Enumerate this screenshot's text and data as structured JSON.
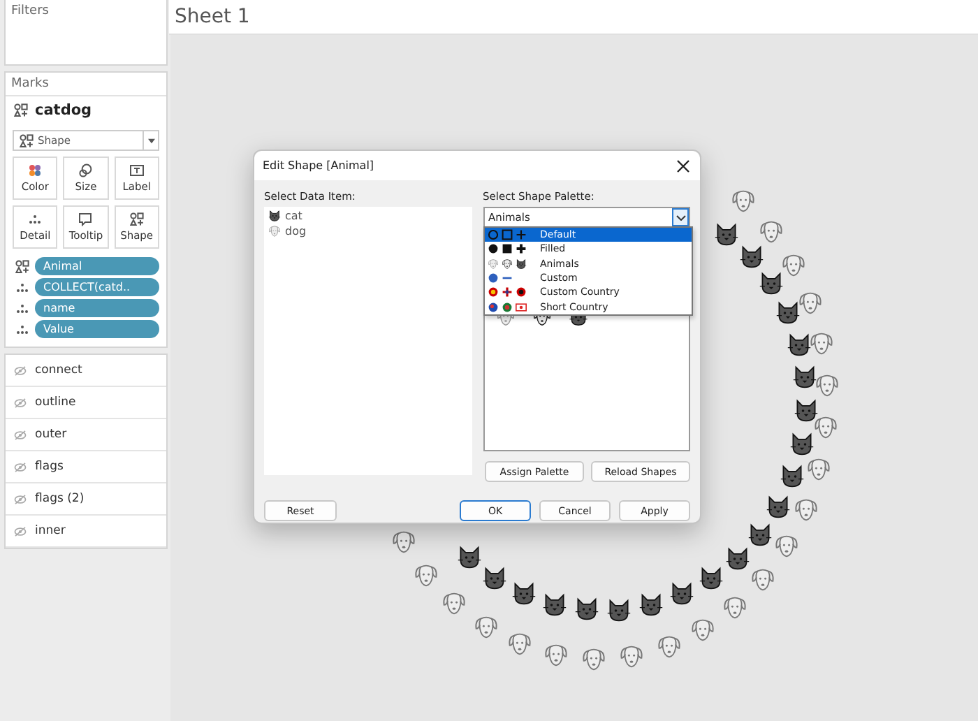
{
  "sidebar": {
    "filters_title": "Filters",
    "marks_title": "Marks",
    "layer_name": "catdog",
    "mark_type": "Shape",
    "mark_buttons": [
      {
        "label": "Color",
        "kind": "color"
      },
      {
        "label": "Size",
        "kind": "size"
      },
      {
        "label": "Label",
        "kind": "label"
      },
      {
        "label": "Detail",
        "kind": "detail"
      },
      {
        "label": "Tooltip",
        "kind": "tooltip"
      },
      {
        "label": "Shape",
        "kind": "shape"
      }
    ],
    "fields": [
      {
        "label": "Animal",
        "kind": "shape"
      },
      {
        "label": "COLLECT(catd..",
        "kind": "detail"
      },
      {
        "label": "name",
        "kind": "detail"
      },
      {
        "label": "Value",
        "kind": "detail"
      }
    ],
    "layers": [
      "connect",
      "outline",
      "outer",
      "flags",
      "flags (2)",
      "inner"
    ]
  },
  "sheet": {
    "title": "Sheet 1"
  },
  "dialog": {
    "title": "Edit Shape [Animal]",
    "data_label": "Select Data Item:",
    "data_items": [
      {
        "label": "cat",
        "kind": "cat"
      },
      {
        "label": "dog",
        "kind": "dog"
      }
    ],
    "palette_label": "Select Shape Palette:",
    "palette_value": "Animals",
    "palette_options": [
      {
        "label": "Default",
        "kind": "default",
        "selected": true
      },
      {
        "label": "Filled",
        "kind": "filled",
        "selected": false
      },
      {
        "label": "Animals",
        "kind": "animals",
        "selected": false
      },
      {
        "label": "Custom",
        "kind": "custom",
        "selected": false
      },
      {
        "label": "Custom Country",
        "kind": "custom_country",
        "selected": false
      },
      {
        "label": "Short Country",
        "kind": "short_country",
        "selected": false
      }
    ],
    "palette_buttons": [
      "Assign Palette",
      "Reload Shapes"
    ],
    "reset": "Reset",
    "buttons": [
      {
        "label": "OK",
        "kind": "default"
      },
      {
        "label": "Cancel",
        "kind": "normal"
      },
      {
        "label": "Apply",
        "kind": "normal"
      }
    ]
  }
}
